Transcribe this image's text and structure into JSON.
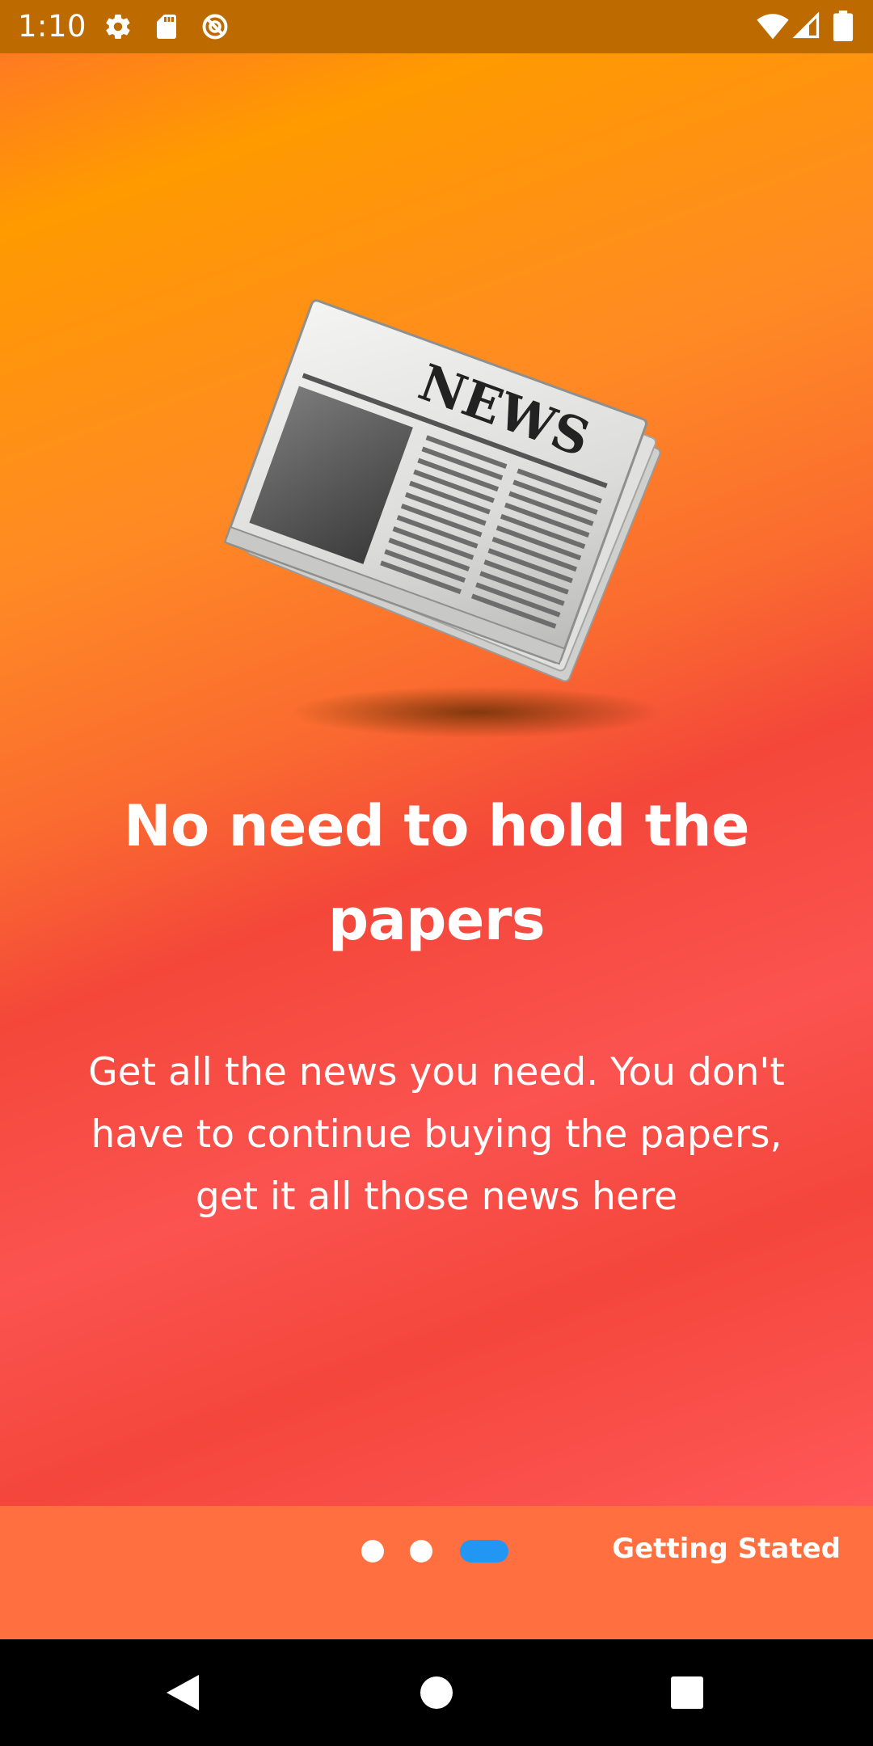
{
  "status_bar": {
    "time": "1:10",
    "left_icons": [
      "settings-icon",
      "sd-card-icon",
      "no-sync-icon"
    ],
    "right_icons": [
      "wifi-icon",
      "signal-icon",
      "battery-icon"
    ],
    "background_color": "#bd6a00"
  },
  "onboarding": {
    "illustration_icon": "newspaper-icon",
    "illustration_text": "NEWS",
    "title": "No need to hold the papers",
    "subtitle": "Get all the news you need. You don't have to continue buying the papers, get it all those news here",
    "page_indicator": {
      "total": 3,
      "current": 3,
      "active_color": "#2196f3",
      "inactive_color": "#ffffff"
    },
    "action_label": "Getting Stated"
  },
  "colors": {
    "gradient_top": "#ff9a00",
    "gradient_bottom": "#ff5858",
    "bottom_strip": "#ff6f3f"
  },
  "navigation_bar": {
    "buttons": [
      "back-icon",
      "home-icon",
      "recents-icon"
    ]
  }
}
